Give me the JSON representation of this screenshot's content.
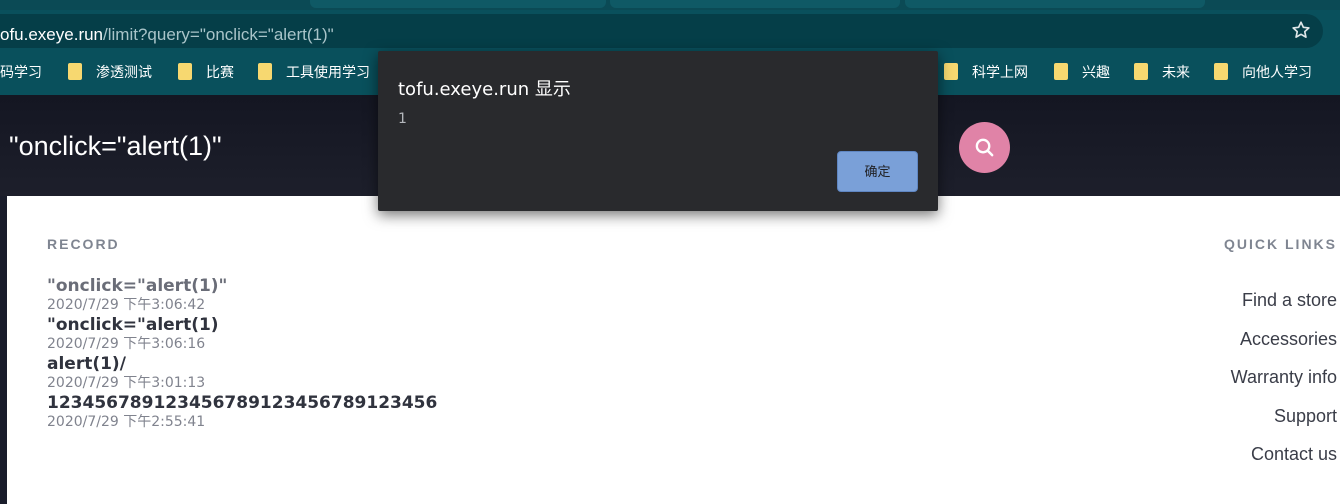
{
  "browser": {
    "url_host": "ofu.exeye.run",
    "url_path": "/limit?query=\"onclick=\"alert(1)\"",
    "bookmark_star_icon": "star-icon",
    "bookmarks": [
      {
        "label": "码学习",
        "folder": false
      },
      {
        "label": "渗透测试",
        "folder": true
      },
      {
        "label": "比赛",
        "folder": true
      },
      {
        "label": "工具使用学习",
        "folder": true
      },
      {
        "label": "科学上网",
        "folder": true
      },
      {
        "label": "兴趣",
        "folder": true
      },
      {
        "label": "未来",
        "folder": true
      },
      {
        "label": "向他人学习",
        "folder": true
      }
    ]
  },
  "header": {
    "query_text": "\"onclick=\"alert(1)\"",
    "search_icon": "search-icon",
    "search_button_color": "#e083a7"
  },
  "record": {
    "title": "RECORD",
    "items": [
      {
        "query": "\"onclick=\"alert(1)\"",
        "time": "2020/7/29 下午3:06:42"
      },
      {
        "query": "\"onclick=\"alert(1)",
        "time": "2020/7/29 下午3:06:16"
      },
      {
        "query": "alert(1)/",
        "time": "2020/7/29 下午3:01:13"
      },
      {
        "query": "12345678912345678912345678912345​6",
        "time": "2020/7/29 下午2:55:41"
      }
    ]
  },
  "quick_links": {
    "title": "QUICK LINKS",
    "items": [
      "Find a store",
      "Accessories",
      "Warranty info",
      "Support",
      "Contact us"
    ]
  },
  "dialog": {
    "title": "tofu.exeye.run 显示",
    "message": "1",
    "ok_label": "确定",
    "ok_color": "#7aa0d8"
  }
}
